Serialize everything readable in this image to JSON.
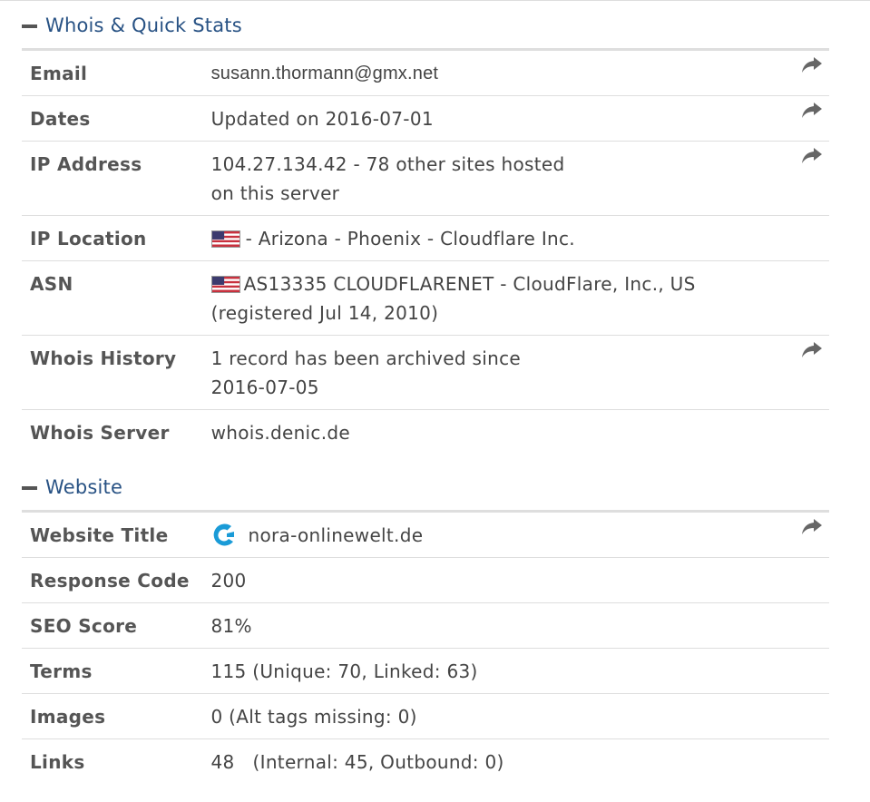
{
  "sections": {
    "whois": {
      "title": "Whois & Quick Stats",
      "rows": {
        "email": {
          "label": "Email",
          "value": "susann.thormann@gmx.net"
        },
        "dates": {
          "label": "Dates",
          "value": "Updated on 2016-07-01"
        },
        "ip_address": {
          "label": "IP Address",
          "value_line1": "104.27.134.42 - 78 other sites hosted",
          "value_line2": "on this server"
        },
        "ip_location": {
          "label": "IP Location",
          "value": "- Arizona - Phoenix - Cloudflare Inc.",
          "flag": "us-flag-icon"
        },
        "asn": {
          "label": "ASN",
          "value_line1": "AS13335 CLOUDFLARENET - CloudFlare, Inc., US",
          "value_line2": "(registered Jul 14, 2010)",
          "flag": "us-flag-icon"
        },
        "whois_history": {
          "label": "Whois History",
          "value_line1": "1 record has been archived since",
          "value_line2": "2016-07-05"
        },
        "whois_server": {
          "label": "Whois Server",
          "value": "whois.denic.de"
        }
      }
    },
    "website": {
      "title": "Website",
      "rows": {
        "website_title": {
          "label": "Website Title",
          "value": "nora-onlinewelt.de",
          "icon": "site-favicon-icon"
        },
        "response_code": {
          "label": "Response Code",
          "value": "200"
        },
        "seo_score": {
          "label": "SEO Score",
          "value": "81%"
        },
        "terms": {
          "label": "Terms",
          "value": "115 (Unique: 70, Linked: 63)"
        },
        "images": {
          "label": "Images",
          "value": "0 (Alt tags missing: 0)"
        },
        "links": {
          "label": "Links",
          "value": "48   (Internal: 45, Outbound: 0)"
        }
      }
    }
  },
  "colors": {
    "section_title": "#285284",
    "label": "#555555",
    "value": "#444444",
    "divider": "#dedede",
    "icon": "#666666",
    "favicon": "#1a9bd7"
  },
  "icons": {
    "collapse": "minus-icon",
    "share": "share-arrow-icon"
  }
}
